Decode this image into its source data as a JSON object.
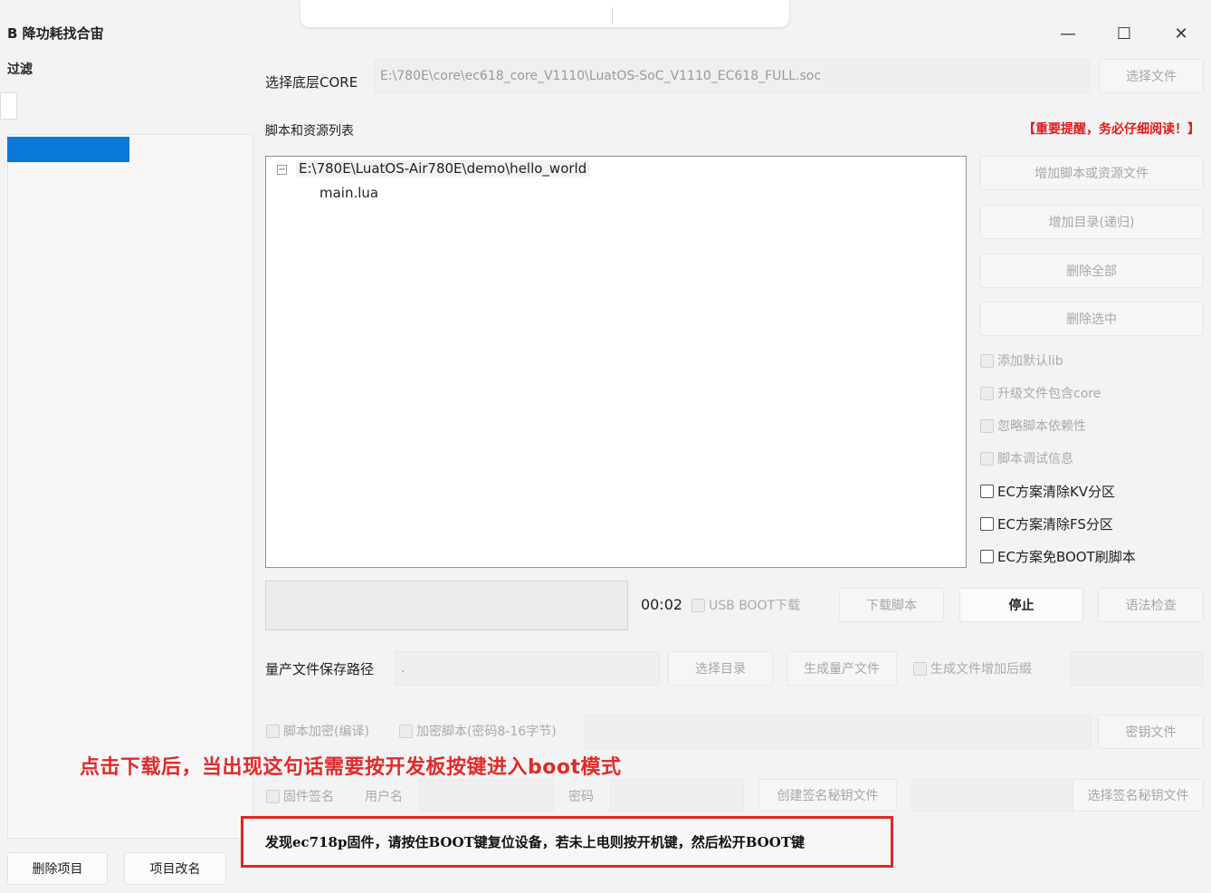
{
  "window": {
    "title": "B 降功耗找合宙",
    "controls": {
      "minimize": "—",
      "maximize": "☐",
      "close": "✕"
    }
  },
  "sidebar": {
    "filter_label": "过滤",
    "delete_project": "删除项目",
    "rename_project": "项目改名"
  },
  "core": {
    "label": "选择底层CORE",
    "path": "E:\\780E\\core\\ec618_core_V1110\\LuatOS-SoC_V1110_EC618_FULL.soc",
    "choose_button": "选择文件"
  },
  "scripts": {
    "label": "脚本和资源列表",
    "warning": "【重要提醒，务必仔细阅读！】",
    "tree_root": "E:\\780E\\LuatOS-Air780E\\demo\\hello_world",
    "tree_child": "main.lua",
    "toggle_glyph": "−"
  },
  "side_buttons": {
    "add_files": "增加脚本或资源文件",
    "add_dir": "增加目录(递归)",
    "delete_all": "删除全部",
    "delete_selected": "删除选中"
  },
  "options": {
    "add_default_lib": "添加默认lib",
    "upgrade_with_core": "升级文件包含core",
    "ignore_deps": "忽略脚本依赖性",
    "debug_info": "脚本调试信息",
    "ec_clear_kv": "EC方案清除KV分区",
    "ec_clear_fs": "EC方案清除FS分区",
    "ec_no_boot": "EC方案免BOOT刷脚本"
  },
  "download": {
    "timer": "00:02",
    "usb_boot": "USB BOOT下载",
    "download_script": "下载脚本",
    "stop": "停止",
    "syntax_check": "语法检查"
  },
  "mass_production": {
    "label": "量产文件保存路径",
    "path_value": ".",
    "choose_dir": "选择目录",
    "generate": "生成量产文件",
    "add_suffix": "生成文件增加后缀"
  },
  "encryption": {
    "encrypt_compile": "脚本加密(编译)",
    "encrypt_password": "加密脚本(密码8-16字节)",
    "key_file": "密钥文件"
  },
  "signing": {
    "firmware_sign": "固件签名",
    "username": "用户名",
    "password": "密码",
    "create_key": "创建签名秘钥文件",
    "choose_key": "选择签名秘钥文件"
  },
  "annotation": "点击下载后，当出现这句话需要按开发板按键进入boot模式",
  "status_message": "发现ec718p固件，请按住BOOT键复位设备，若未上电则按开机键，然后松开BOOT键",
  "colors": {
    "accent_blue": "#0a78d7",
    "annotation_red": "#e12a2a",
    "warning_red": "#e01a1a"
  }
}
